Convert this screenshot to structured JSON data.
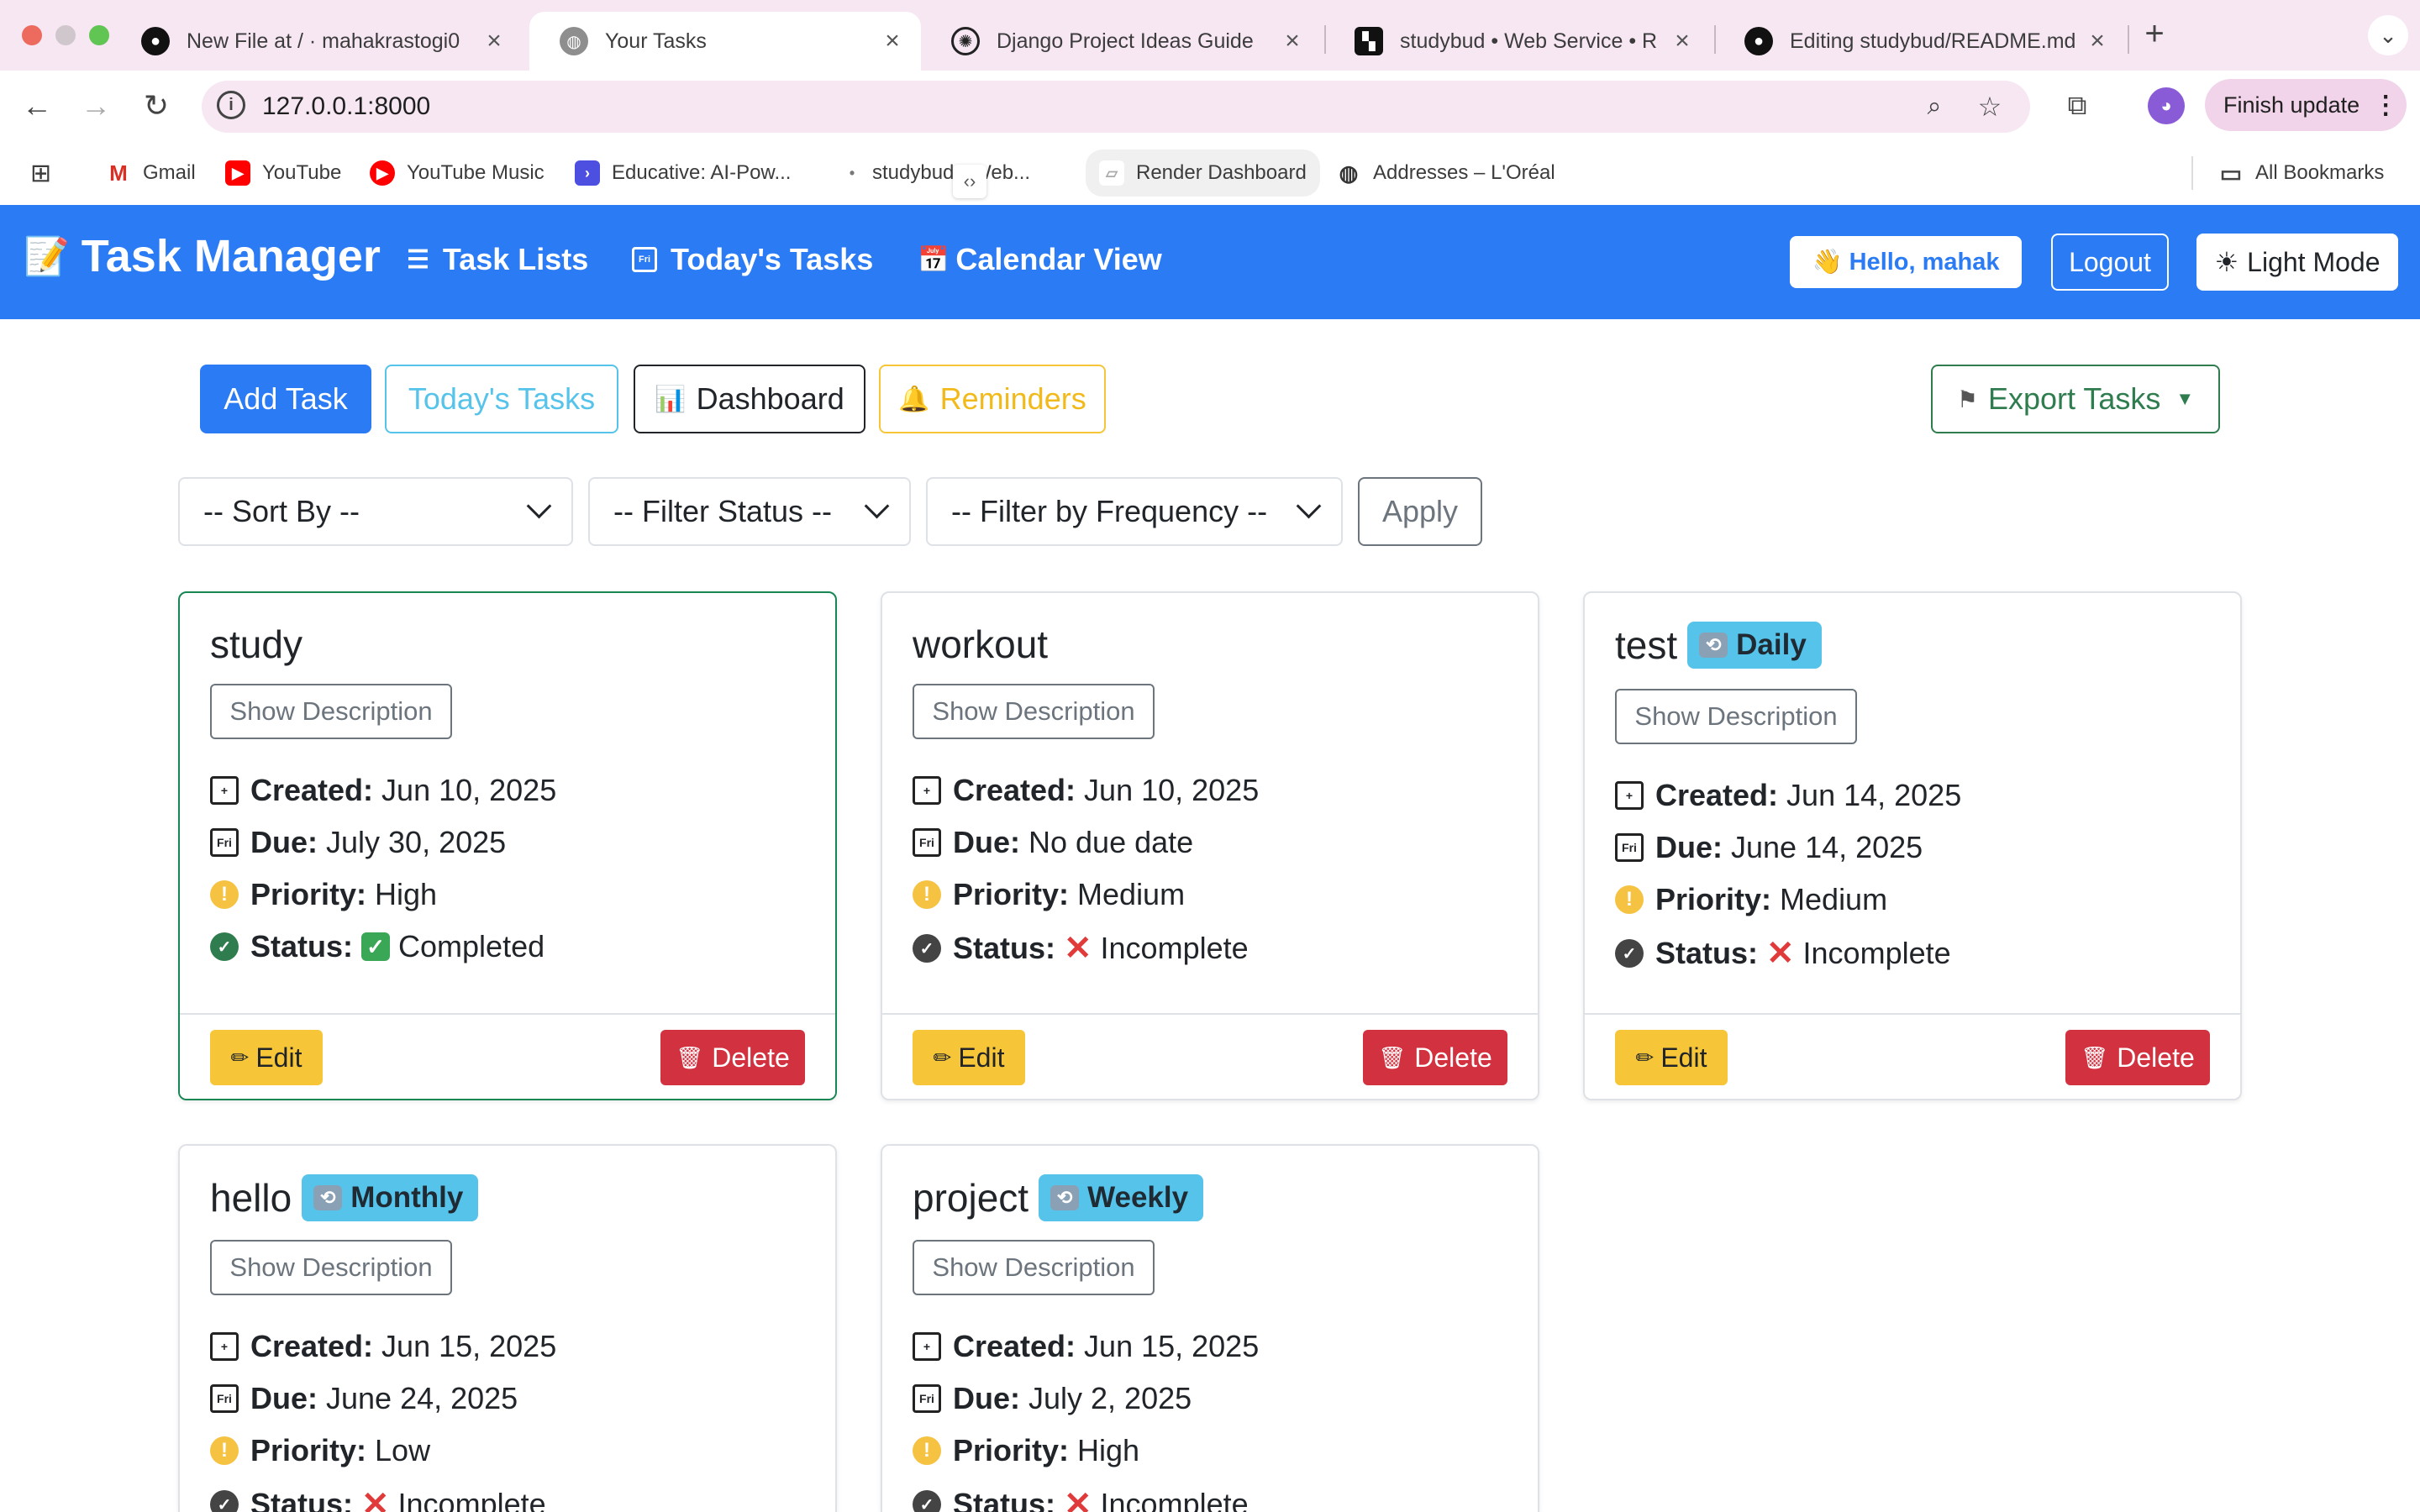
{
  "browser": {
    "tabs": [
      {
        "title": "New File at / · mahakrastogi0",
        "icon": "github-icon"
      },
      {
        "title": "Your Tasks",
        "icon": "globe-icon"
      },
      {
        "title": "Django Project Ideas Guide",
        "icon": "openai-icon"
      },
      {
        "title": "studybud • Web Service • R",
        "icon": "render-icon"
      },
      {
        "title": "Editing studybud/README.md",
        "icon": "github-icon"
      }
    ],
    "address": "127.0.0.1:8000",
    "finish_update": "Finish update",
    "bookmarks": [
      {
        "label": "Gmail"
      },
      {
        "label": "YouTube"
      },
      {
        "label": "YouTube Music"
      },
      {
        "label": "Educative: AI-Pow..."
      },
      {
        "label": "studybud • Web..."
      },
      {
        "label": "Render Dashboard"
      },
      {
        "label": "Addresses – L'Oréal"
      }
    ],
    "all_bookmarks": "All Bookmarks"
  },
  "navbar": {
    "brand": "Task Manager",
    "links": [
      "Task Lists",
      "Today's Tasks",
      "Calendar View"
    ],
    "hello": "👋 Hello, mahak",
    "logout": "Logout",
    "light_mode": "Light Mode",
    "color": "#2b7cf4"
  },
  "actions": {
    "add_task": "Add Task",
    "todays_tasks": "Today's Tasks",
    "dashboard": "Dashboard",
    "reminders": "Reminders",
    "export_tasks": "Export Tasks"
  },
  "filters": {
    "sort_by": "-- Sort By --",
    "filter_status": "-- Filter Status --",
    "filter_frequency": "-- Filter by Frequency --",
    "apply": "Apply"
  },
  "labels": {
    "show_description": "Show Description",
    "created": "Created:",
    "due": "Due:",
    "priority": "Priority:",
    "status": "Status:",
    "edit": "Edit",
    "delete": "Delete"
  },
  "tasks": [
    {
      "title": "study",
      "frequency": "",
      "created": "Jun 10, 2025",
      "due": "July 30, 2025",
      "priority": "High",
      "status": "Completed"
    },
    {
      "title": "workout",
      "frequency": "",
      "created": "Jun 10, 2025",
      "due": "No due date",
      "priority": "Medium",
      "status": "Incomplete"
    },
    {
      "title": "test",
      "frequency": "Daily",
      "created": "Jun 14, 2025",
      "due": "June 14, 2025",
      "priority": "Medium",
      "status": "Incomplete"
    },
    {
      "title": "hello",
      "frequency": "Monthly",
      "created": "Jun 15, 2025",
      "due": "June 24, 2025",
      "priority": "Low",
      "status": "Incomplete"
    },
    {
      "title": "project",
      "frequency": "Weekly",
      "created": "Jun 15, 2025",
      "due": "July 2, 2025",
      "priority": "High",
      "status": "Incomplete"
    }
  ]
}
